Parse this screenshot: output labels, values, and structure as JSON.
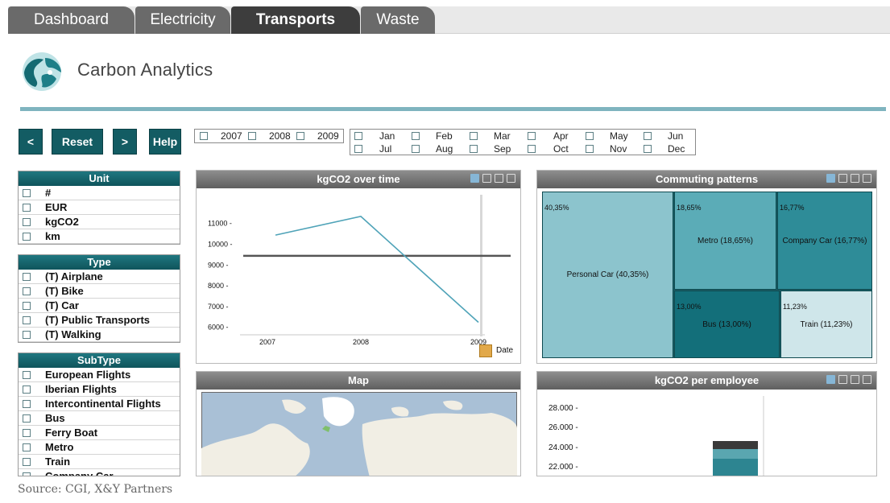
{
  "tabs": [
    "Dashboard",
    "Electricity",
    "Transports",
    "Waste"
  ],
  "active_tab": "Transports",
  "brand": "Carbon Analytics",
  "buttons": {
    "prev": "<",
    "reset": "Reset",
    "next": ">",
    "help": "Help"
  },
  "years": [
    "2007",
    "2008",
    "2009"
  ],
  "months": [
    "Jan",
    "Feb",
    "Mar",
    "Apr",
    "May",
    "Jun",
    "Jul",
    "Aug",
    "Sep",
    "Oct",
    "Nov",
    "Dec"
  ],
  "unit_box": {
    "title": "Unit",
    "items": [
      "#",
      "EUR",
      "kgCO2",
      "km"
    ]
  },
  "type_box": {
    "title": "Type",
    "items": [
      "(T) Airplane",
      "(T) Bike",
      "(T) Car",
      "(T) Public Transports",
      "(T) Walking"
    ]
  },
  "subtype_box": {
    "title": "SubType",
    "items": [
      "European Flights",
      "Iberian Flights",
      "Intercontinental Flights",
      "Bus",
      "Ferry Boat",
      "Metro",
      "Train",
      "Company Car"
    ]
  },
  "panels": {
    "kgco2_time": "kgCO2 over time",
    "commuting": "Commuting patterns",
    "map": "Map",
    "per_employee": "kgCO2 per employee"
  },
  "line_chart": {
    "y_ticks": [
      "11000 -",
      "10000 -",
      "9000 -",
      "8000 -",
      "7000 -",
      "6000 -"
    ],
    "x_ticks": [
      "2007",
      "2008",
      "2009"
    ],
    "date_label": "Date"
  },
  "treemap": [
    {
      "pct": "40,35%",
      "label": "Personal Car (40,35%)",
      "color": "#8cc4cd"
    },
    {
      "pct": "18,65%",
      "label": "Metro (18,65%)",
      "color": "#5bacb7"
    },
    {
      "pct": "16,77%",
      "label": "Company Car (16,77%)",
      "color": "#2e8c98"
    },
    {
      "pct": "13,00%",
      "label": "Bus (13,00%)",
      "color": "#136f7a"
    },
    {
      "pct": "11,23%",
      "label": "Train (11,23%)",
      "color": "#cfe6ea"
    }
  ],
  "employee_chart": {
    "y_ticks": [
      "28.000 -",
      "26.000 -",
      "24.000 -",
      "22.000 -"
    ]
  },
  "source": "Source: CGI, X&Y Partners",
  "chart_data": [
    {
      "type": "line",
      "title": "kgCO2 over time",
      "x": [
        "2007",
        "2008",
        "2009"
      ],
      "series": [
        {
          "values": [
            10400,
            11300,
            6200
          ]
        },
        {
          "values": [
            9400,
            9400,
            9400
          ]
        }
      ],
      "ylim": [
        5600,
        11800
      ],
      "grid": false
    }
  ]
}
